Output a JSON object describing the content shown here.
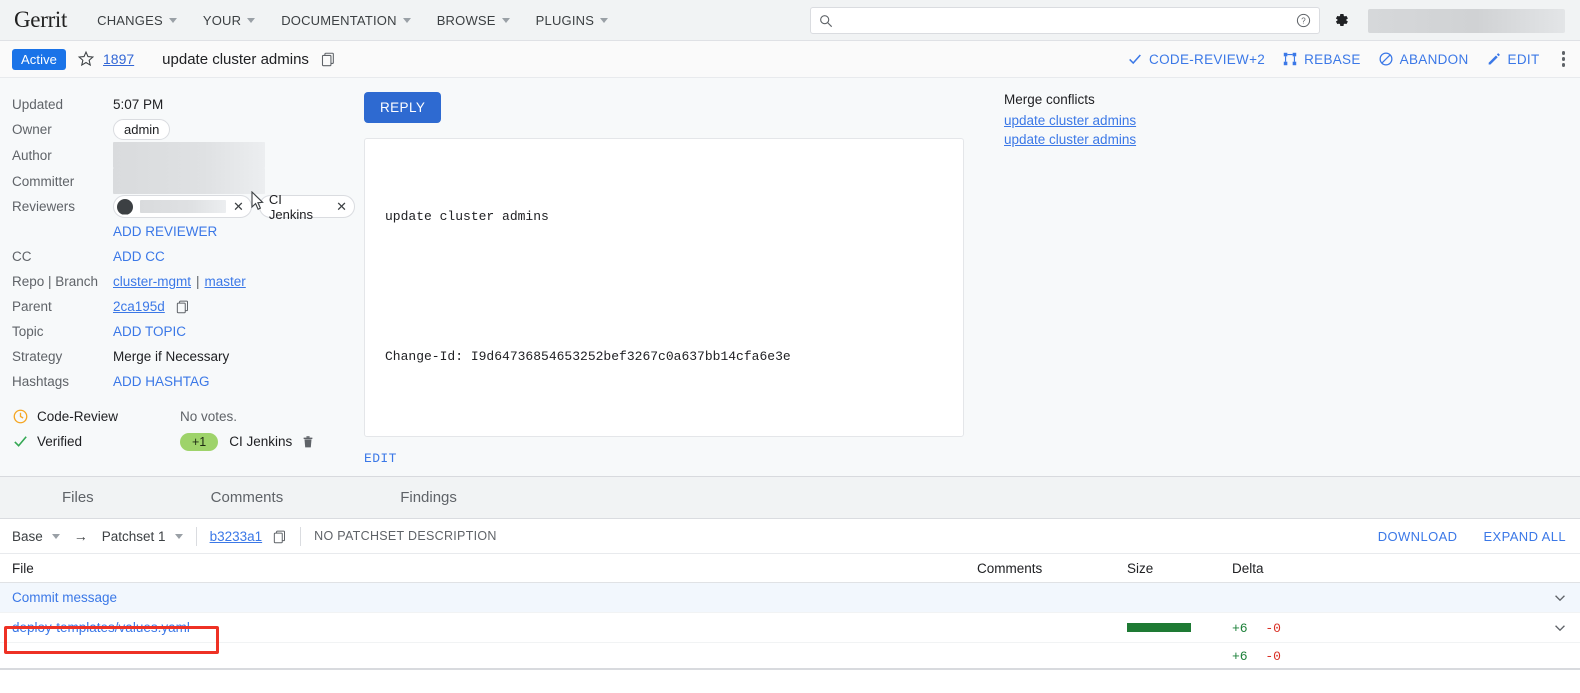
{
  "app": {
    "brand": "Gerrit"
  },
  "nav": {
    "items": [
      {
        "label": "CHANGES",
        "has_caret": true
      },
      {
        "label": "YOUR",
        "has_caret": true
      },
      {
        "label": "DOCUMENTATION",
        "has_caret": true
      },
      {
        "label": "BROWSE",
        "has_caret": true
      },
      {
        "label": "PLUGINS",
        "has_caret": true
      }
    ],
    "search_placeholder": "",
    "search_value": ""
  },
  "change_header": {
    "status": "Active",
    "change_number": "1897",
    "title": "update cluster admins",
    "actions": [
      {
        "label": "CODE-REVIEW+2",
        "icon": "check-icon"
      },
      {
        "label": "REBASE",
        "icon": "rebase-icon"
      },
      {
        "label": "ABANDON",
        "icon": "block-icon"
      },
      {
        "label": "EDIT",
        "icon": "pencil-icon"
      }
    ]
  },
  "metadata": {
    "updated_label": "Updated",
    "updated_value": "5:07 PM",
    "owner_label": "Owner",
    "owner_value": "admin",
    "author_label": "Author",
    "author_value": "",
    "committer_label": "Committer",
    "committer_value": "",
    "reviewers_label": "Reviewers",
    "reviewers": [
      {
        "name": "",
        "redacted": true
      },
      {
        "name": "CI Jenkins",
        "redacted": false
      }
    ],
    "add_reviewer": "ADD REVIEWER",
    "cc_label": "CC",
    "add_cc": "ADD CC",
    "repo_branch_label": "Repo | Branch",
    "repo": "cluster-mgmt",
    "branch_sep": "|",
    "branch": "master",
    "parent_label": "Parent",
    "parent_value": "2ca195d",
    "topic_label": "Topic",
    "add_topic": "ADD TOPIC",
    "strategy_label": "Strategy",
    "strategy_value": "Merge if Necessary",
    "hashtags_label": "Hashtags",
    "add_hashtag": "ADD HASHTAG"
  },
  "labels": [
    {
      "name": "Code-Review",
      "icon": "clock-icon",
      "status_text": "No votes.",
      "vote": null,
      "voter": null
    },
    {
      "name": "Verified",
      "icon": "check-icon",
      "status_text": "",
      "vote": "+1",
      "voter": "CI Jenkins"
    }
  ],
  "commit": {
    "reply_label": "REPLY",
    "message_subject": "update cluster admins",
    "message_changeid": "Change-Id: I9d64736854653252bef3267c0a637bb14cfa6e3e",
    "edit_label": "EDIT"
  },
  "conflicts": {
    "title": "Merge conflicts",
    "links": [
      "update cluster admins",
      "update cluster admins"
    ]
  },
  "tabs": [
    {
      "label": "Files",
      "active": true
    },
    {
      "label": "Comments",
      "active": false
    },
    {
      "label": "Findings",
      "active": false
    }
  ],
  "patchset_bar": {
    "base_label": "Base",
    "arrow": "→",
    "patchset_label": "Patchset 1",
    "hash": "b3233a1",
    "description": "NO PATCHSET DESCRIPTION",
    "download_label": "DOWNLOAD",
    "expand_all_label": "EXPAND ALL"
  },
  "file_table": {
    "columns": {
      "file": "File",
      "comments": "Comments",
      "size": "Size",
      "delta": "Delta"
    },
    "rows": [
      {
        "file": "Commit message",
        "comments": "",
        "size_bar": false,
        "added": "",
        "deleted": "",
        "highlighted": false
      },
      {
        "file": "deploy-templates/values.yaml",
        "comments": "",
        "size_bar": true,
        "added": "+6",
        "deleted": "-0",
        "highlighted": true
      }
    ],
    "totals": {
      "added": "+6",
      "deleted": "-0"
    }
  },
  "colors": {
    "accent_blue": "#1a73e8",
    "link_blue": "#3b78e7",
    "reply_blue": "#2e6ad1",
    "vote_green": "#9ed36a",
    "size_bar_green": "#1e7a34",
    "added_green": "#1a7f37",
    "deleted_red": "#d93025",
    "annotation_red": "#ee3124"
  }
}
